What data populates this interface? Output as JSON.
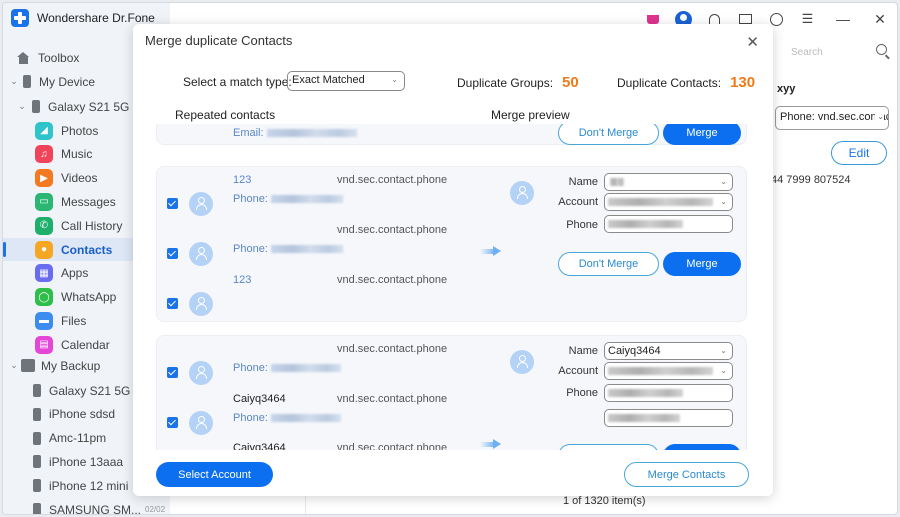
{
  "app": {
    "title": "Wondershare Dr.Fone",
    "topbar_icons": [
      "cart-icon",
      "account-icon",
      "headset-icon",
      "mail-icon",
      "history-icon",
      "menu-icon",
      "minimize-icon",
      "close-icon"
    ]
  },
  "sidebar": {
    "toolbox": "Toolbox",
    "my_device": "My Device",
    "device_name": "Galaxy S21 5G",
    "apps": [
      {
        "label": "Photos",
        "icon": "photos-icon",
        "color": "#2ec4c9"
      },
      {
        "label": "Music",
        "icon": "music-icon",
        "color": "#f0445a"
      },
      {
        "label": "Videos",
        "icon": "videos-icon",
        "color": "#f47a22"
      },
      {
        "label": "Messages",
        "icon": "messages-icon",
        "color": "#2bb673"
      },
      {
        "label": "Call History",
        "icon": "call-history-icon",
        "color": "#1fae6b"
      },
      {
        "label": "Contacts",
        "icon": "contacts-icon",
        "color": "#f5a623",
        "active": true
      },
      {
        "label": "Apps",
        "icon": "apps-icon",
        "color": "#6a6cf0"
      },
      {
        "label": "WhatsApp",
        "icon": "whatsapp-icon",
        "color": "#2fbe4a"
      },
      {
        "label": "Files",
        "icon": "files-icon",
        "color": "#3d8cf0"
      },
      {
        "label": "Calendar",
        "icon": "calendar-icon",
        "color": "#e447d8"
      }
    ],
    "my_backup": "My Backup",
    "backups": [
      "Galaxy S21 5G",
      "iPhone  sdsd",
      "Amc-11pm",
      "iPhone 13aaa",
      "iPhone 12 mini",
      "SAMSUNG SM..."
    ],
    "backup_date_partial": "02/02"
  },
  "right_panel": {
    "search_placeholder": "Search",
    "contact_name": "xyy",
    "phone_select": "Phone: vnd.sec.contact.phone",
    "edit_label": "Edit",
    "phone_number": "44 7999 807524"
  },
  "footer": {
    "count": "1 of 1320 item(s)"
  },
  "modal": {
    "title": "Merge duplicate Contacts",
    "match_type_label": "Select a match type:",
    "match_type_value": "Exact Matched",
    "duplicate_groups_label": "Duplicate Groups:",
    "duplicate_groups_value": "50",
    "duplicate_contacts_label": "Duplicate Contacts:",
    "duplicate_contacts_value": "130",
    "repeated_header": "Repeated contacts",
    "preview_header": "Merge preview",
    "dont_merge_label": "Don't Merge",
    "merge_label": "Merge",
    "select_account_label": "Select Account",
    "merge_contacts_label": "Merge Contacts",
    "prev_group": {
      "email_label": "Email:"
    },
    "group1": {
      "contacts": [
        {
          "name": "123",
          "type": "vnd.sec.contact.phone",
          "phone_label": "Phone:"
        },
        {
          "name": "",
          "type": "vnd.sec.contact.phone",
          "phone_label": "Phone:"
        },
        {
          "name": "123",
          "type": "vnd.sec.contact.phone",
          "phone_label": ""
        }
      ],
      "preview": {
        "name_label": "Name",
        "account_label": "Account",
        "phone_label": "Phone"
      }
    },
    "group2": {
      "contacts": [
        {
          "name": "",
          "type": "vnd.sec.contact.phone",
          "phone_label": "Phone:"
        },
        {
          "name": "Caiyq3464",
          "type": "vnd.sec.contact.phone",
          "phone_label": "Phone:"
        },
        {
          "name": "Caiyq3464",
          "type": "vnd.sec.contact.phone",
          "phone_label": ""
        }
      ],
      "preview": {
        "name_label": "Name",
        "name_value": "Caiyq3464",
        "account_label": "Account",
        "phone_label": "Phone"
      }
    }
  }
}
